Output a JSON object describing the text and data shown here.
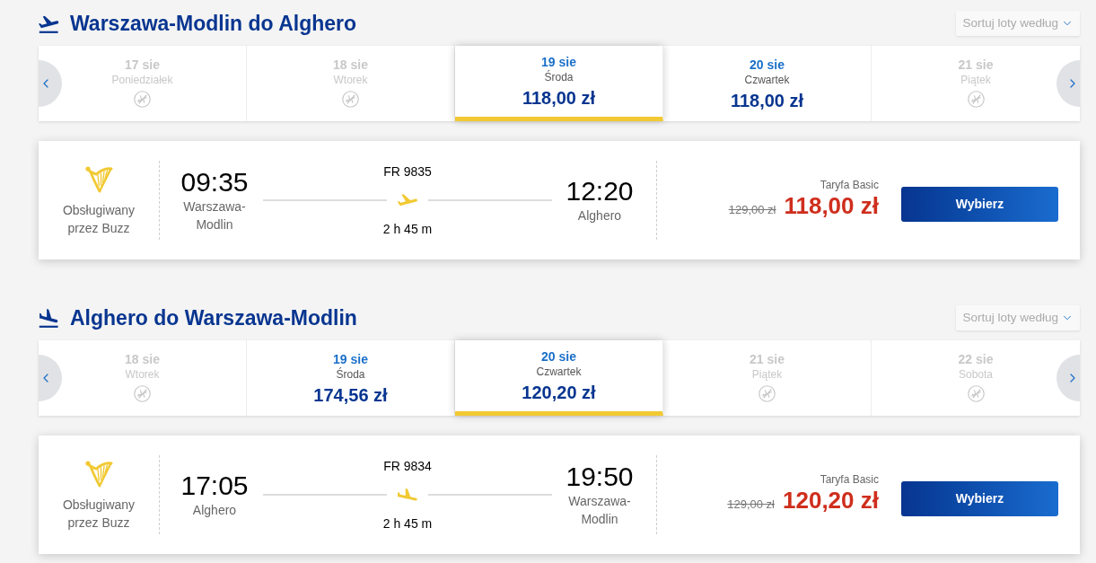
{
  "sections": [
    {
      "kind": "outbound",
      "title": "Warszawa-Modlin do Alghero",
      "sort": "Sortuj loty według",
      "dates": [
        {
          "date": "17 sie",
          "weekday": "Poniedziałek",
          "disabled": true,
          "selected": false
        },
        {
          "date": "18 sie",
          "weekday": "Wtorek",
          "disabled": true,
          "selected": false
        },
        {
          "date": "19 sie",
          "weekday": "Środa",
          "price": "118,00 zł",
          "disabled": false,
          "selected": true
        },
        {
          "date": "20 sie",
          "weekday": "Czwartek",
          "price": "118,00 zł",
          "disabled": false,
          "selected": false
        },
        {
          "date": "21 sie",
          "weekday": "Piątek",
          "disabled": true,
          "selected": false
        }
      ],
      "flight": {
        "operator": "Obsługiwany przez Buzz",
        "departure_time": "09:35",
        "departure_airport": "Warszawa-Modlin",
        "flight_number": "FR 9835",
        "duration": "2 h 45 m",
        "arrival_time": "12:20",
        "arrival_airport": "Alghero",
        "fare": "Taryfa Basic",
        "old_price": "129,00 zł",
        "price": "118,00 zł",
        "button": "Wybierz"
      }
    },
    {
      "kind": "inbound",
      "title": "Alghero do Warszawa-Modlin",
      "sort": "Sortuj loty według",
      "dates": [
        {
          "date": "18 sie",
          "weekday": "Wtorek",
          "disabled": true,
          "selected": false
        },
        {
          "date": "19 sie",
          "weekday": "Środa",
          "price": "174,56 zł",
          "disabled": false,
          "selected": false
        },
        {
          "date": "20 sie",
          "weekday": "Czwartek",
          "price": "120,20 zł",
          "disabled": false,
          "selected": true
        },
        {
          "date": "21 sie",
          "weekday": "Piątek",
          "disabled": true,
          "selected": false
        },
        {
          "date": "22 sie",
          "weekday": "Sobota",
          "disabled": true,
          "selected": false
        }
      ],
      "flight": {
        "operator": "Obsługiwany przez Buzz",
        "departure_time": "17:05",
        "departure_airport": "Alghero",
        "flight_number": "FR 9834",
        "duration": "2 h 45 m",
        "arrival_time": "19:50",
        "arrival_airport": "Warszawa-Modlin",
        "fare": "Taryfa Basic",
        "old_price": "129,00 zł",
        "price": "120,20 zł",
        "button": "Wybierz"
      }
    }
  ]
}
